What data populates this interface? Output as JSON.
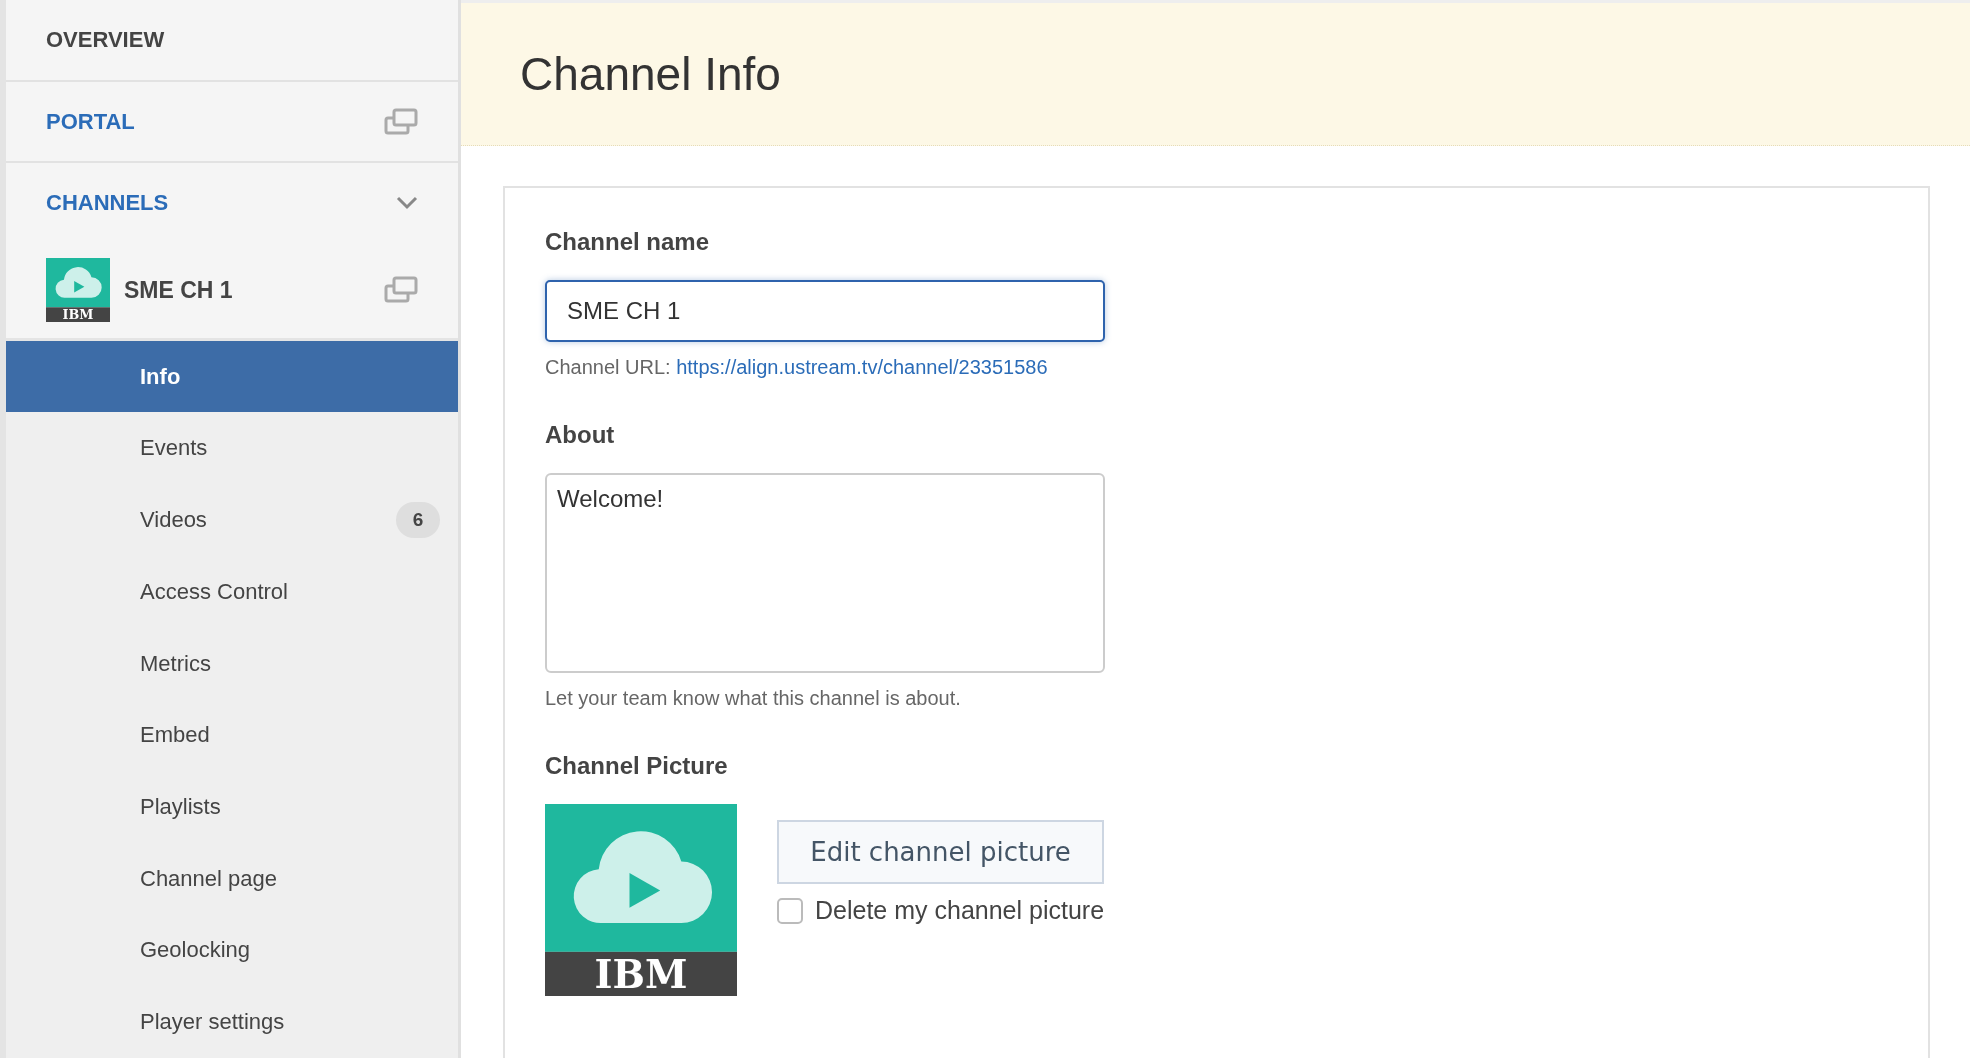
{
  "sidebar": {
    "sections": [
      {
        "kind": "plain",
        "label": "OVERVIEW"
      },
      {
        "kind": "external",
        "label": "PORTAL"
      },
      {
        "kind": "expandable",
        "label": "CHANNELS",
        "expanded": true
      }
    ],
    "channel": {
      "name": "SME CH 1",
      "logo_text": "IBM"
    },
    "items": [
      {
        "label": "Info",
        "selected": true
      },
      {
        "label": "Events",
        "selected": false
      },
      {
        "label": "Videos",
        "selected": false,
        "badge": "6"
      },
      {
        "label": "Access Control",
        "selected": false
      },
      {
        "label": "Metrics",
        "selected": false
      },
      {
        "label": "Embed",
        "selected": false
      },
      {
        "label": "Playlists",
        "selected": false
      },
      {
        "label": "Channel page",
        "selected": false
      },
      {
        "label": "Geolocking",
        "selected": false
      },
      {
        "label": "Player settings",
        "selected": false
      }
    ]
  },
  "header": {
    "title": "Channel Info"
  },
  "form": {
    "name_label": "Channel name",
    "name_value": "SME CH 1",
    "url_label": "Channel URL:",
    "url": "https://align.ustream.tv/channel/23351586",
    "about_label": "About",
    "about_value": "Welcome!",
    "about_hint": "Let your team know what this channel is about.",
    "picture_label": "Channel Picture",
    "picture_logo_text": "IBM",
    "edit_button": "Edit channel picture",
    "delete_checkbox": {
      "label": "Delete my channel picture",
      "checked": false
    }
  }
}
